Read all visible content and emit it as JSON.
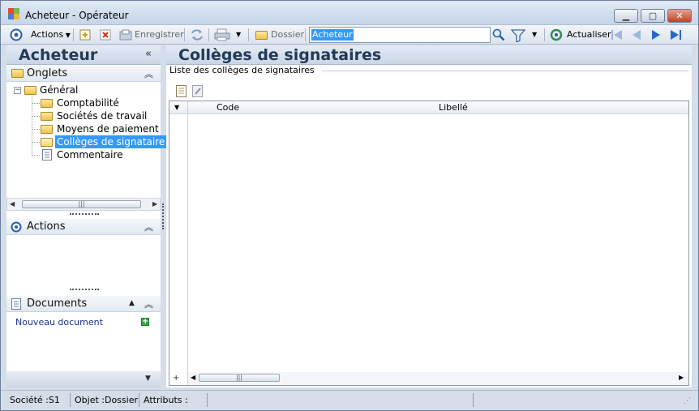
{
  "window": {
    "title_app": "Acheteur",
    "title_separator": "-",
    "title_user": "Opérateur"
  },
  "toolbar": {
    "actions_label": "Actions",
    "save_label": "Enregistrer",
    "folder_label": "Dossier",
    "search_value": "Acheteur",
    "refresh_label": "Actualiser"
  },
  "left": {
    "title": "Acheteur",
    "tabs_section": "Onglets",
    "tree": {
      "root": "Général",
      "children": [
        "Comptabilité",
        "Sociétés de travail",
        "Moyens de paiement",
        "Collèges de signataire",
        "Commentaire"
      ],
      "selected_index": 3
    },
    "actions_section": "Actions",
    "documents_section": "Documents",
    "new_document": "Nouveau document"
  },
  "main": {
    "title": "Collèges de signataires",
    "group_label": "Liste des collèges de signataires",
    "columns": [
      "Code",
      "Libellé"
    ],
    "rows": []
  },
  "status": {
    "company": "Société :S1",
    "object": "Objet :Dossier",
    "attributes": "Attributs :"
  },
  "colors": {
    "accent": "#3399ff",
    "header_text": "#233a57",
    "link": "#1a2f8a"
  }
}
